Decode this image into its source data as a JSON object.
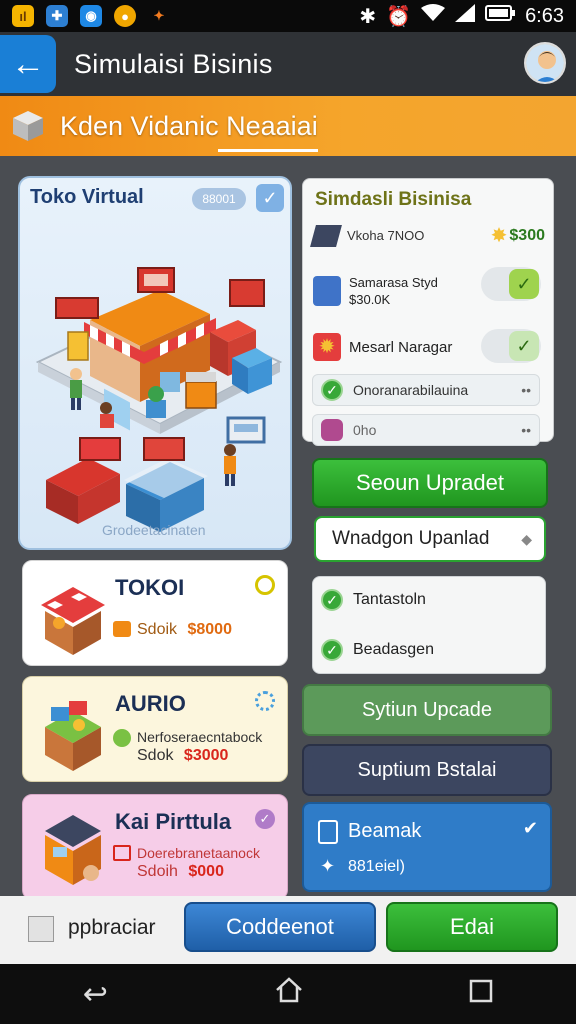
{
  "status_bar": {
    "time": "6:63",
    "icons": [
      "bluetooth-icon",
      "alarm-icon",
      "wifi-icon",
      "signal-icon",
      "battery-icon"
    ]
  },
  "app_bar": {
    "title": "Simulaisi Bisinis"
  },
  "banner": {
    "title": "Kden Vidanic Neaaiai"
  },
  "stage": {
    "title": "Toko Virtual",
    "pill": "88001",
    "caption": "Grodeetacinaten"
  },
  "cards": [
    {
      "title": "TOKOI",
      "line1": "Sdoik",
      "price": "$8000",
      "color": "#ffffff"
    },
    {
      "title": "AURIO",
      "line1": "Nerfoseraecntabock",
      "line2": "Sdok",
      "price": "$3000",
      "color": "#fcf6dd"
    },
    {
      "title": "Kai Pirttula",
      "line1": "Doerebranetaanock",
      "line2": "Sdoih",
      "price": "$000",
      "color": "#f6cde8"
    }
  ],
  "right_panel": {
    "title": "Simdasli Bisinisa",
    "row1_label": "Vkoha 7NOO",
    "row1_price": "$300",
    "row2_label": "Samarasa Styd",
    "row2_sub": "$30.0K",
    "row3_label": "Mesarl Naragar"
  },
  "list_rows": [
    {
      "label": "Onoranarabilauina"
    },
    {
      "label": "0ho"
    }
  ],
  "buttons": {
    "green_primary": "Seoun Upradet",
    "outline": "Wnadgon Upanlad",
    "sage": "Sytiun Upcade",
    "slate": "Suptium Bstalai",
    "share_title": "Beamak",
    "share_sub": "881eiel)"
  },
  "checklist": [
    {
      "label": "Tantastoln"
    },
    {
      "label": "Beadasgen"
    }
  ],
  "bottom_bar": {
    "label": "ppbraciar",
    "blue_button": "Coddeenot",
    "green_button": "Edai"
  },
  "colors": {
    "accent_blue": "#1a7fd6",
    "banner_orange": "#f08a14",
    "green": "#2aa331",
    "slate": "#3c4660"
  }
}
